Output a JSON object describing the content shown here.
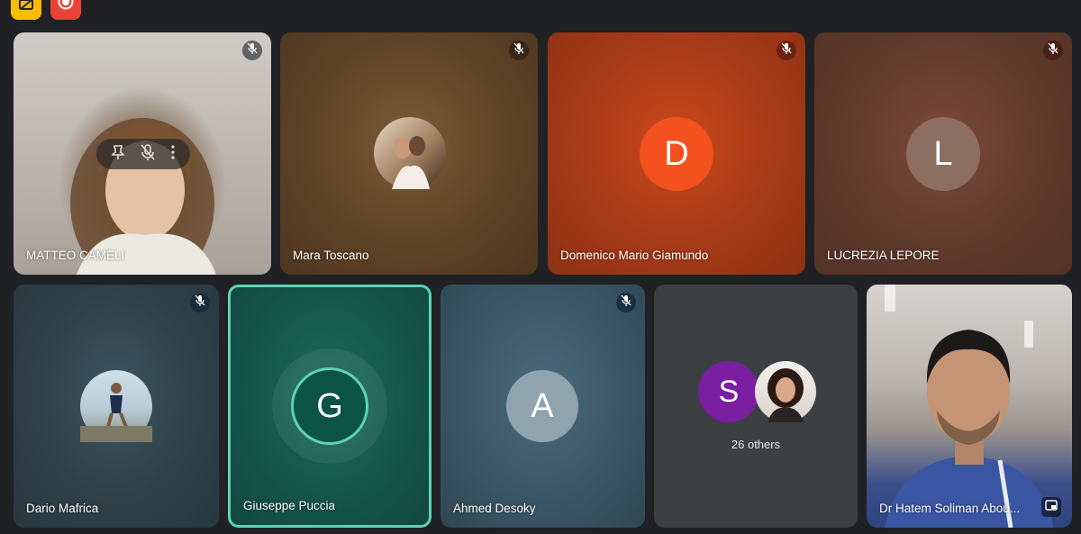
{
  "toolbar": {
    "buttons": [
      {
        "icon": "captions-off-icon",
        "color": "#fbbc04"
      },
      {
        "icon": "record-icon",
        "color": "#ea4335"
      }
    ]
  },
  "participants": [
    {
      "name": "MATTEO CAMELI",
      "muted": true,
      "type": "video"
    },
    {
      "name": "Mara Toscano",
      "muted": true,
      "type": "photo"
    },
    {
      "name": "Domenico Mario Giamundo",
      "muted": true,
      "initial": "D",
      "avatar_color": "#f4511e"
    },
    {
      "name": "LUCREZIA LEPORE",
      "muted": true,
      "initial": "L",
      "avatar_color": "#8d6e63"
    },
    {
      "name": "Dario Mafrica",
      "muted": true,
      "type": "photo"
    },
    {
      "name": "Giuseppe Puccia",
      "muted": false,
      "speaking": true,
      "initial": "G",
      "avatar_color": "#0b5345"
    },
    {
      "name": "Ahmed Desoky",
      "muted": true,
      "initial": "A",
      "avatar_color": "#90a4ae"
    },
    {
      "name": "Dr Hatem Soliman Abou...",
      "muted": false,
      "type": "video"
    }
  ],
  "others": {
    "initial": "S",
    "avatar_color": "#7b1fa2",
    "label": "26 others"
  },
  "colors": {
    "speaking_border": "#5fd2b5",
    "background": "#202124"
  }
}
